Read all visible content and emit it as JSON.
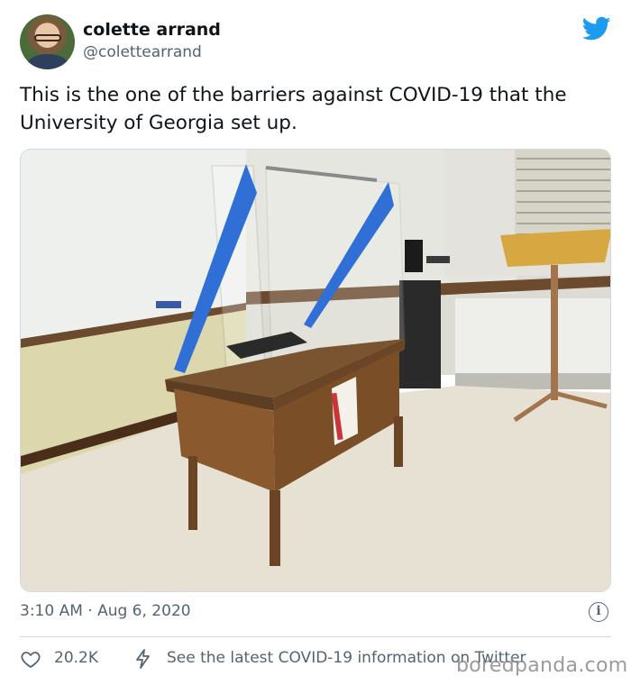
{
  "author": {
    "name": "colette arrand",
    "handle": "@colettearrand",
    "avatar_icon": "profile-avatar"
  },
  "tweet": {
    "text": "This is the one of the barriers against COVID-19 that the University of Georgia set up.",
    "photo_icon": "classroom-desk-with-plexiglass-barrier-photo",
    "timestamp": "3:10 AM · Aug 6, 2020"
  },
  "actions": {
    "like_icon": "heart-icon",
    "like_count": "20.2K",
    "info_icon": "info-icon",
    "covid_icon": "lightning-icon",
    "covid_label": "See the latest COVID-19 information on Twitter"
  },
  "brand": {
    "logo_icon": "twitter-bird-icon",
    "accent": "#1d9bf0",
    "watermark": "boredpanda.com"
  }
}
